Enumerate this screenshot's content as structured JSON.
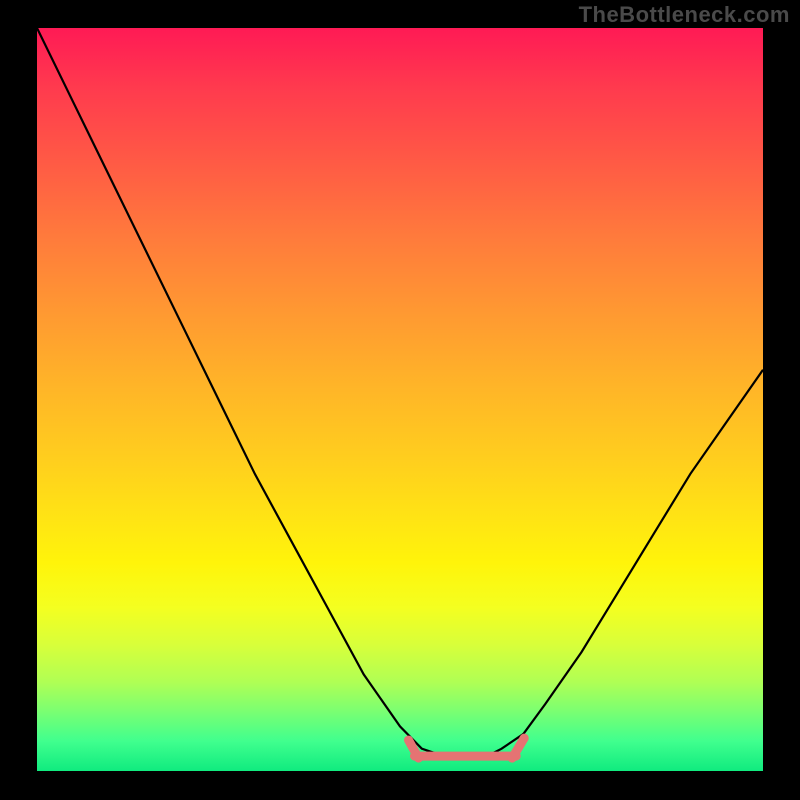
{
  "watermark": "TheBottleneck.com",
  "chart_data": {
    "type": "line",
    "title": "",
    "xlabel": "",
    "ylabel": "",
    "series": [
      {
        "name": "curve",
        "x": [
          0.0,
          0.05,
          0.1,
          0.15,
          0.2,
          0.25,
          0.3,
          0.35,
          0.4,
          0.45,
          0.5,
          0.53,
          0.56,
          0.59,
          0.62,
          0.64,
          0.67,
          0.7,
          0.75,
          0.8,
          0.85,
          0.9,
          0.95,
          1.0
        ],
        "y": [
          1.0,
          0.9,
          0.8,
          0.7,
          0.6,
          0.5,
          0.4,
          0.31,
          0.22,
          0.13,
          0.06,
          0.03,
          0.02,
          0.02,
          0.02,
          0.03,
          0.05,
          0.09,
          0.16,
          0.24,
          0.32,
          0.4,
          0.47,
          0.54
        ]
      },
      {
        "name": "marker_band",
        "x": [
          0.52,
          0.58,
          0.66
        ],
        "y": [
          0.025,
          0.02,
          0.035
        ]
      }
    ],
    "xlim": [
      0,
      1
    ],
    "ylim": [
      0,
      1
    ],
    "annotations": [],
    "legend": false,
    "grid": false
  },
  "colors": {
    "curve": "#000000",
    "marker": "#e57373",
    "background_top": "#ff1a55",
    "background_bottom": "#10eb7f",
    "frame": "#000000"
  }
}
